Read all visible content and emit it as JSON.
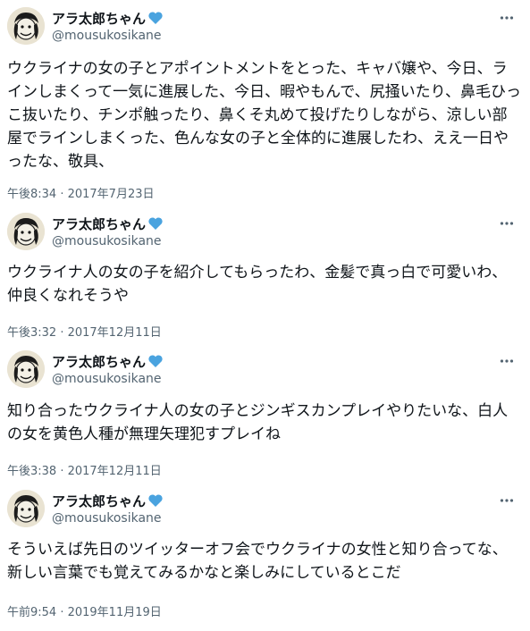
{
  "colors": {
    "text": "#0f1419",
    "secondary": "#536471",
    "verified": "#4aa3df",
    "background": "#ffffff"
  },
  "icons": {
    "verified": "heart-icon",
    "more": "more-horizontal-icon",
    "avatar": "avatar-image"
  },
  "tweets": [
    {
      "display_name": "アラ太郎ちゃん",
      "handle": "@mousukosikane",
      "text": "ウクライナの女の子とアポイントメントをとった、キャバ嬢や、今日、ラインしまくって一気に進展した、今日、暇やもんで、尻掻いたり、鼻毛ひっこ抜いたり、チンポ触ったり、鼻くそ丸めて投げたりしながら、涼しい部屋でラインしまくった、色んな女の子と全体的に進展したわ、ええ一日やったな、敬具、",
      "timestamp": "午後8:34 · 2017年7月23日"
    },
    {
      "display_name": "アラ太郎ちゃん",
      "handle": "@mousukosikane",
      "text": "ウクライナ人の女の子を紹介してもらったわ、金髪で真っ白で可愛いわ、仲良くなれそうや",
      "timestamp": "午後3:32 · 2017年12月11日"
    },
    {
      "display_name": "アラ太郎ちゃん",
      "handle": "@mousukosikane",
      "text": "知り合ったウクライナ人の女の子とジンギスカンプレイやりたいな、白人の女を黄色人種が無理矢理犯すプレイね",
      "timestamp": "午後3:38 · 2017年12月11日"
    },
    {
      "display_name": "アラ太郎ちゃん",
      "handle": "@mousukosikane",
      "text": "そういえば先日のツイッターオフ会でウクライナの女性と知り合ってな、新しい言葉でも覚えてみるかなと楽しみにしているとこだ",
      "timestamp": "午前9:54 · 2019年11月19日"
    }
  ]
}
